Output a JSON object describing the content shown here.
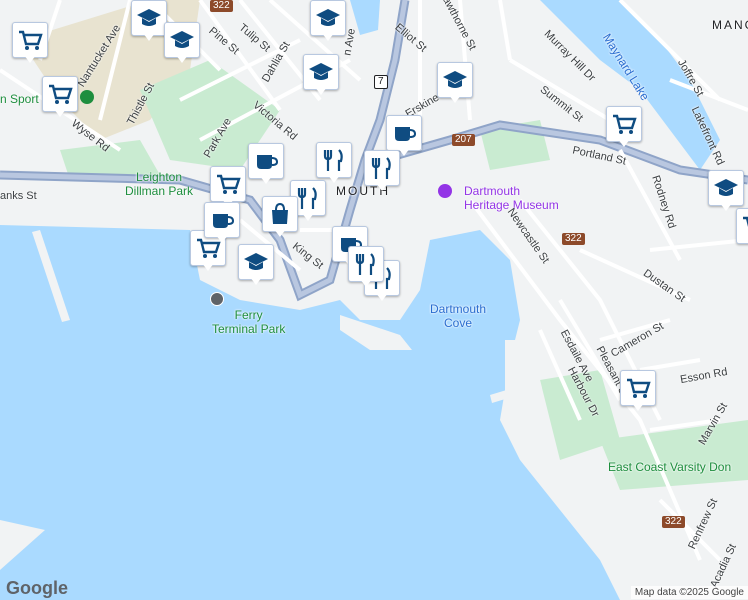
{
  "colors": {
    "water": "#aadaff",
    "land": "#f1f3f4",
    "park": "#c9ebd1",
    "highway": "#8fa4c8",
    "road": "#ffffff",
    "pin_icon": "#0f4c81"
  },
  "labels": {
    "nantucket_ave": "Nantucket Ave",
    "pine_st": "Pine St",
    "tulip_st": "Tulip St",
    "dahlia_st": "Dahlia St",
    "thistle_st": "Thistle St",
    "wyse_rd": "Wyse Rd",
    "sport": "n Sport",
    "park_ave": "Park Ave",
    "victoria_rd": "Victoria Rd",
    "leighton_dillman_park": "Leighton\nDillman Park",
    "banks_st": "anks St",
    "king_st": "King St",
    "ferry_terminal_park": "Ferry\nTerminal Park",
    "dartmouth": "MOUTH",
    "elliot_st": "Elliot St",
    "hawthorne_st": "Hawthorne St",
    "erskine": "Erskine",
    "maynard_lake": "Maynard Lake",
    "murray_hill_dr": "Murray Hill Dr",
    "summit_st": "Summit St",
    "joffre_st": "Joffre St",
    "lakefront_rd": "Lakefront Rd",
    "mang": "MANG",
    "portland_st": "Portland St",
    "rodney_rd": "Rodney Rd",
    "dartmouth_heritage_museum": "Dartmouth\nHeritage Museum",
    "newcastle_st": "Newcastle St",
    "dustan_st": "Dustan St",
    "dartmouth_cove": "Dartmouth\nCove",
    "cameron_st": "Cameron St",
    "esson_rd": "Esson Rd",
    "esdaile_ave": "Esdaile Ave",
    "harbour_dr": "Harbour Dr",
    "pleasant_st": "Pleasant St",
    "marvin_st": "Marvin St",
    "east_coast_varsity": "East Coast Varsity Don",
    "renfrew_st": "Renfrew St",
    "acadia_st": "Acadia St",
    "ave": "n Ave"
  },
  "shields": {
    "r7": "7",
    "r207": "207",
    "r322a": "322",
    "r322b": "322",
    "r322c": "322",
    "r7b": "7"
  },
  "pins": [
    {
      "icon": "school"
    },
    {
      "icon": "school"
    },
    {
      "icon": "school"
    },
    {
      "icon": "school"
    },
    {
      "icon": "school"
    },
    {
      "icon": "grocery"
    },
    {
      "icon": "grocery"
    },
    {
      "icon": "grocery"
    },
    {
      "icon": "grocery"
    },
    {
      "icon": "cafe"
    },
    {
      "icon": "cafe"
    },
    {
      "icon": "restaurant"
    },
    {
      "icon": "restaurant"
    }
  ],
  "footer": {
    "logo": "Google",
    "attribution": "Map data ©2025 Google"
  }
}
